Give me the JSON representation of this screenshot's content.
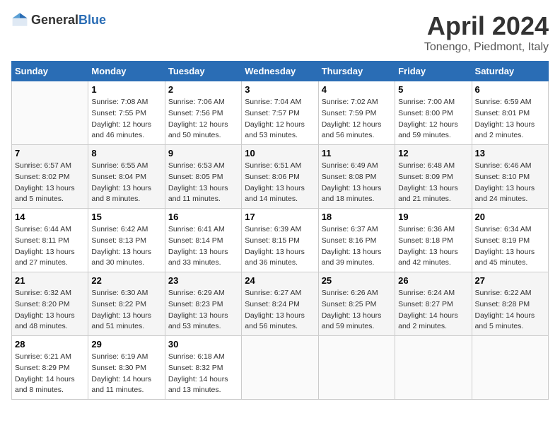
{
  "logo": {
    "general": "General",
    "blue": "Blue"
  },
  "title": "April 2024",
  "subtitle": "Tonengo, Piedmont, Italy",
  "weekdays": [
    "Sunday",
    "Monday",
    "Tuesday",
    "Wednesday",
    "Thursday",
    "Friday",
    "Saturday"
  ],
  "weeks": [
    [
      {
        "day": "",
        "sunrise": "",
        "sunset": "",
        "daylight": ""
      },
      {
        "day": "1",
        "sunrise": "Sunrise: 7:08 AM",
        "sunset": "Sunset: 7:55 PM",
        "daylight": "Daylight: 12 hours and 46 minutes."
      },
      {
        "day": "2",
        "sunrise": "Sunrise: 7:06 AM",
        "sunset": "Sunset: 7:56 PM",
        "daylight": "Daylight: 12 hours and 50 minutes."
      },
      {
        "day": "3",
        "sunrise": "Sunrise: 7:04 AM",
        "sunset": "Sunset: 7:57 PM",
        "daylight": "Daylight: 12 hours and 53 minutes."
      },
      {
        "day": "4",
        "sunrise": "Sunrise: 7:02 AM",
        "sunset": "Sunset: 7:59 PM",
        "daylight": "Daylight: 12 hours and 56 minutes."
      },
      {
        "day": "5",
        "sunrise": "Sunrise: 7:00 AM",
        "sunset": "Sunset: 8:00 PM",
        "daylight": "Daylight: 12 hours and 59 minutes."
      },
      {
        "day": "6",
        "sunrise": "Sunrise: 6:59 AM",
        "sunset": "Sunset: 8:01 PM",
        "daylight": "Daylight: 13 hours and 2 minutes."
      }
    ],
    [
      {
        "day": "7",
        "sunrise": "Sunrise: 6:57 AM",
        "sunset": "Sunset: 8:02 PM",
        "daylight": "Daylight: 13 hours and 5 minutes."
      },
      {
        "day": "8",
        "sunrise": "Sunrise: 6:55 AM",
        "sunset": "Sunset: 8:04 PM",
        "daylight": "Daylight: 13 hours and 8 minutes."
      },
      {
        "day": "9",
        "sunrise": "Sunrise: 6:53 AM",
        "sunset": "Sunset: 8:05 PM",
        "daylight": "Daylight: 13 hours and 11 minutes."
      },
      {
        "day": "10",
        "sunrise": "Sunrise: 6:51 AM",
        "sunset": "Sunset: 8:06 PM",
        "daylight": "Daylight: 13 hours and 14 minutes."
      },
      {
        "day": "11",
        "sunrise": "Sunrise: 6:49 AM",
        "sunset": "Sunset: 8:08 PM",
        "daylight": "Daylight: 13 hours and 18 minutes."
      },
      {
        "day": "12",
        "sunrise": "Sunrise: 6:48 AM",
        "sunset": "Sunset: 8:09 PM",
        "daylight": "Daylight: 13 hours and 21 minutes."
      },
      {
        "day": "13",
        "sunrise": "Sunrise: 6:46 AM",
        "sunset": "Sunset: 8:10 PM",
        "daylight": "Daylight: 13 hours and 24 minutes."
      }
    ],
    [
      {
        "day": "14",
        "sunrise": "Sunrise: 6:44 AM",
        "sunset": "Sunset: 8:11 PM",
        "daylight": "Daylight: 13 hours and 27 minutes."
      },
      {
        "day": "15",
        "sunrise": "Sunrise: 6:42 AM",
        "sunset": "Sunset: 8:13 PM",
        "daylight": "Daylight: 13 hours and 30 minutes."
      },
      {
        "day": "16",
        "sunrise": "Sunrise: 6:41 AM",
        "sunset": "Sunset: 8:14 PM",
        "daylight": "Daylight: 13 hours and 33 minutes."
      },
      {
        "day": "17",
        "sunrise": "Sunrise: 6:39 AM",
        "sunset": "Sunset: 8:15 PM",
        "daylight": "Daylight: 13 hours and 36 minutes."
      },
      {
        "day": "18",
        "sunrise": "Sunrise: 6:37 AM",
        "sunset": "Sunset: 8:16 PM",
        "daylight": "Daylight: 13 hours and 39 minutes."
      },
      {
        "day": "19",
        "sunrise": "Sunrise: 6:36 AM",
        "sunset": "Sunset: 8:18 PM",
        "daylight": "Daylight: 13 hours and 42 minutes."
      },
      {
        "day": "20",
        "sunrise": "Sunrise: 6:34 AM",
        "sunset": "Sunset: 8:19 PM",
        "daylight": "Daylight: 13 hours and 45 minutes."
      }
    ],
    [
      {
        "day": "21",
        "sunrise": "Sunrise: 6:32 AM",
        "sunset": "Sunset: 8:20 PM",
        "daylight": "Daylight: 13 hours and 48 minutes."
      },
      {
        "day": "22",
        "sunrise": "Sunrise: 6:30 AM",
        "sunset": "Sunset: 8:22 PM",
        "daylight": "Daylight: 13 hours and 51 minutes."
      },
      {
        "day": "23",
        "sunrise": "Sunrise: 6:29 AM",
        "sunset": "Sunset: 8:23 PM",
        "daylight": "Daylight: 13 hours and 53 minutes."
      },
      {
        "day": "24",
        "sunrise": "Sunrise: 6:27 AM",
        "sunset": "Sunset: 8:24 PM",
        "daylight": "Daylight: 13 hours and 56 minutes."
      },
      {
        "day": "25",
        "sunrise": "Sunrise: 6:26 AM",
        "sunset": "Sunset: 8:25 PM",
        "daylight": "Daylight: 13 hours and 59 minutes."
      },
      {
        "day": "26",
        "sunrise": "Sunrise: 6:24 AM",
        "sunset": "Sunset: 8:27 PM",
        "daylight": "Daylight: 14 hours and 2 minutes."
      },
      {
        "day": "27",
        "sunrise": "Sunrise: 6:22 AM",
        "sunset": "Sunset: 8:28 PM",
        "daylight": "Daylight: 14 hours and 5 minutes."
      }
    ],
    [
      {
        "day": "28",
        "sunrise": "Sunrise: 6:21 AM",
        "sunset": "Sunset: 8:29 PM",
        "daylight": "Daylight: 14 hours and 8 minutes."
      },
      {
        "day": "29",
        "sunrise": "Sunrise: 6:19 AM",
        "sunset": "Sunset: 8:30 PM",
        "daylight": "Daylight: 14 hours and 11 minutes."
      },
      {
        "day": "30",
        "sunrise": "Sunrise: 6:18 AM",
        "sunset": "Sunset: 8:32 PM",
        "daylight": "Daylight: 14 hours and 13 minutes."
      },
      {
        "day": "",
        "sunrise": "",
        "sunset": "",
        "daylight": ""
      },
      {
        "day": "",
        "sunrise": "",
        "sunset": "",
        "daylight": ""
      },
      {
        "day": "",
        "sunrise": "",
        "sunset": "",
        "daylight": ""
      },
      {
        "day": "",
        "sunrise": "",
        "sunset": "",
        "daylight": ""
      }
    ]
  ]
}
